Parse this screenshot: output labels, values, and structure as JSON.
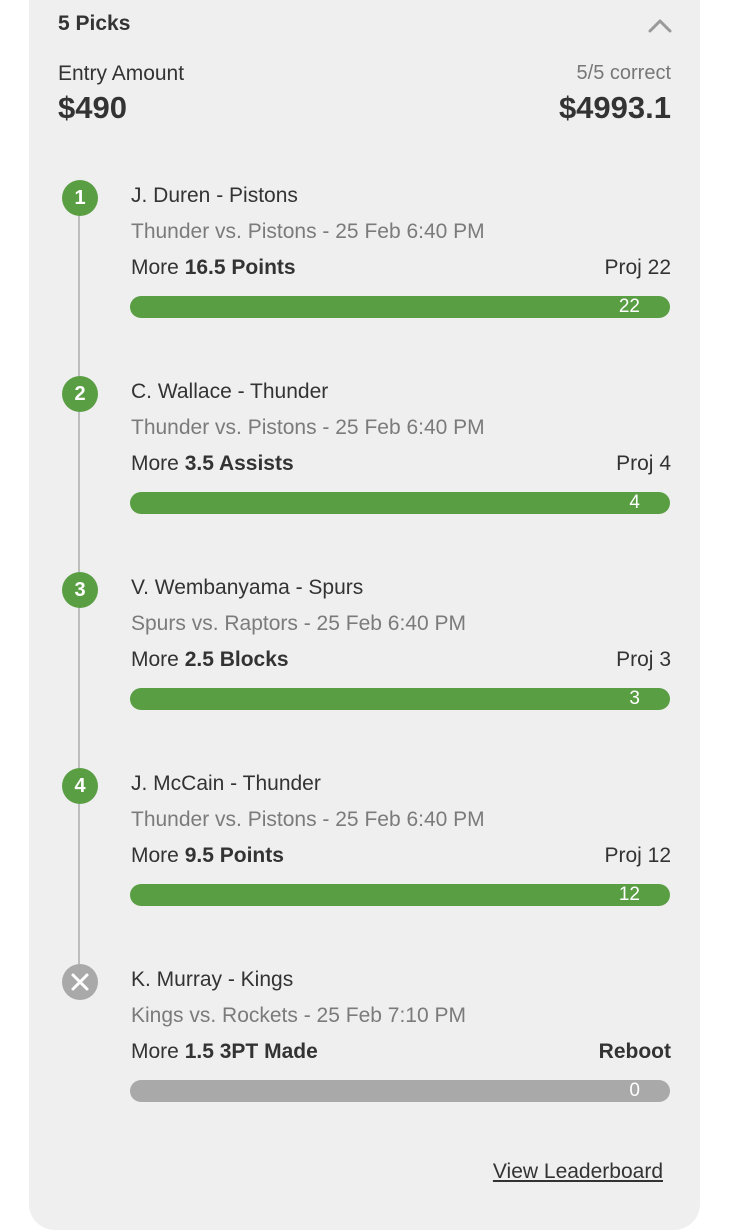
{
  "header": {
    "picks_title": "5 Picks",
    "entry_label": "Entry Amount",
    "entry_amount": "$490",
    "correct_text": "5/5 correct",
    "payout": "$4993.1"
  },
  "picks": [
    {
      "number": "1",
      "player": "J. Duren - Pistons",
      "game": "Thunder vs. Pistons - 25 Feb 6:40 PM",
      "direction": "More",
      "line": "16.5 Points",
      "proj_label": "Proj",
      "proj_value": "22",
      "bar_value": "22",
      "status": "won"
    },
    {
      "number": "2",
      "player": "C. Wallace - Thunder",
      "game": "Thunder vs. Pistons - 25 Feb 6:40 PM",
      "direction": "More",
      "line": "3.5 Assists",
      "proj_label": "Proj",
      "proj_value": "4",
      "bar_value": "4",
      "status": "won"
    },
    {
      "number": "3",
      "player": "V. Wembanyama - Spurs",
      "game": "Spurs vs. Raptors - 25 Feb 6:40 PM",
      "direction": "More",
      "line": "2.5 Blocks",
      "proj_label": "Proj",
      "proj_value": "3",
      "bar_value": "3",
      "status": "won"
    },
    {
      "number": "4",
      "player": "J. McCain - Thunder",
      "game": "Thunder vs. Pistons - 25 Feb 6:40 PM",
      "direction": "More",
      "line": "9.5 Points",
      "proj_label": "Proj",
      "proj_value": "12",
      "bar_value": "12",
      "status": "won"
    },
    {
      "number": "",
      "player": "K. Murray - Kings",
      "game": "Kings vs. Rockets - 25 Feb 7:10 PM",
      "direction": "More",
      "line": "1.5 3PT Made",
      "proj_label": "Reboot",
      "proj_value": "",
      "bar_value": "0",
      "status": "rebooted"
    }
  ],
  "footer": {
    "leaderboard_link": "View Leaderboard"
  },
  "colors": {
    "won": "#5a9e44",
    "rebooted": "#a9a9a9",
    "card_bg": "#efefef"
  },
  "icons": {
    "collapse": "chevron-up-icon",
    "rebooted": "x-icon"
  }
}
